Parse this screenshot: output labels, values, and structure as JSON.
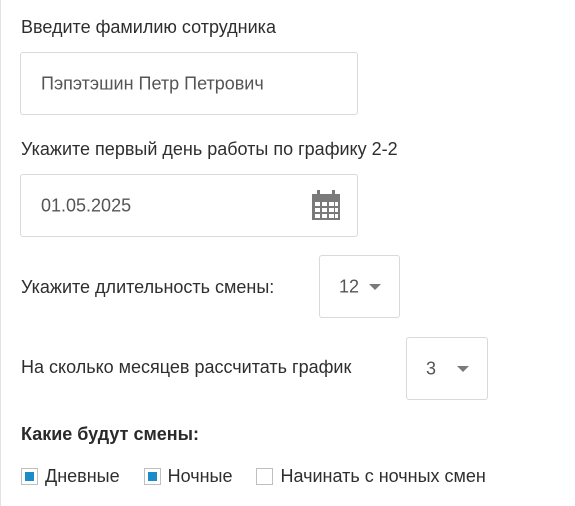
{
  "employee": {
    "label": "Введите фамилию сотрудника",
    "value": "Пэпэтэшин Петр Петрович"
  },
  "start_date": {
    "label": "Укажите первый день работы по графику 2-2",
    "value": "01.05.2025",
    "icon": "calendar-icon"
  },
  "shift_length": {
    "label": "Укажите длительность смены:",
    "value": "12"
  },
  "months": {
    "label": "На сколько месяцев рассчитать график",
    "value": "3"
  },
  "shifts": {
    "heading": "Какие будут смены:",
    "options": [
      {
        "label": "Дневные",
        "checked": true
      },
      {
        "label": "Ночные",
        "checked": true
      },
      {
        "label": "Начинать с ночных смен",
        "checked": false
      }
    ]
  },
  "colors": {
    "accent": "#1b8cc8",
    "border": "#d9d9d9",
    "icon": "#7a7a7a"
  }
}
